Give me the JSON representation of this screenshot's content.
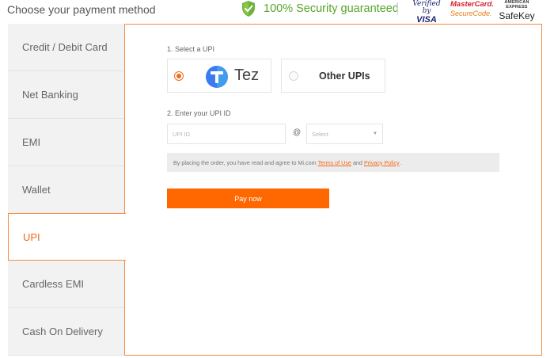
{
  "header": {
    "title": "Choose your payment method",
    "security_text": "100% Security guaranteed",
    "badges": {
      "visa_line1": "Verified by",
      "visa_line2": "VISA",
      "mastercard_line1": "MasterCard.",
      "mastercard_line2": "SecureCode.",
      "amex_line1": "AMERICAN EXPRESS",
      "amex_line2": "SafeKey"
    }
  },
  "sidebar": {
    "items": [
      {
        "label": "Credit / Debit Card",
        "active": false
      },
      {
        "label": "Net Banking",
        "active": false
      },
      {
        "label": "EMI",
        "active": false
      },
      {
        "label": "Wallet",
        "active": false
      },
      {
        "label": "UPI",
        "active": true
      },
      {
        "label": "Cardless EMI",
        "active": false
      },
      {
        "label": "Cash On Delivery",
        "active": false
      }
    ]
  },
  "upi": {
    "select_label": "1. Select a UPI",
    "options": [
      {
        "label": "Tez",
        "selected": true,
        "icon": "tez-logo-icon"
      },
      {
        "label": "Other UPIs",
        "selected": false
      }
    ],
    "enter_label": "2. Enter your UPI ID",
    "upi_id_placeholder": "UPI ID",
    "at_symbol": "@",
    "select_placeholder": "Select",
    "consent_prefix": "By placing the order, you have read and agree to Mi.com",
    "terms_link": "Terms of Use",
    "consent_and": "and",
    "privacy_link": "Privacy Policy",
    "consent_suffix": ".",
    "pay_button": "Pay now"
  },
  "colors": {
    "accent": "#f06a1a",
    "pay_button": "#ff6700",
    "security_green": "#56a62a",
    "tab_background": "#f2f2f2"
  }
}
